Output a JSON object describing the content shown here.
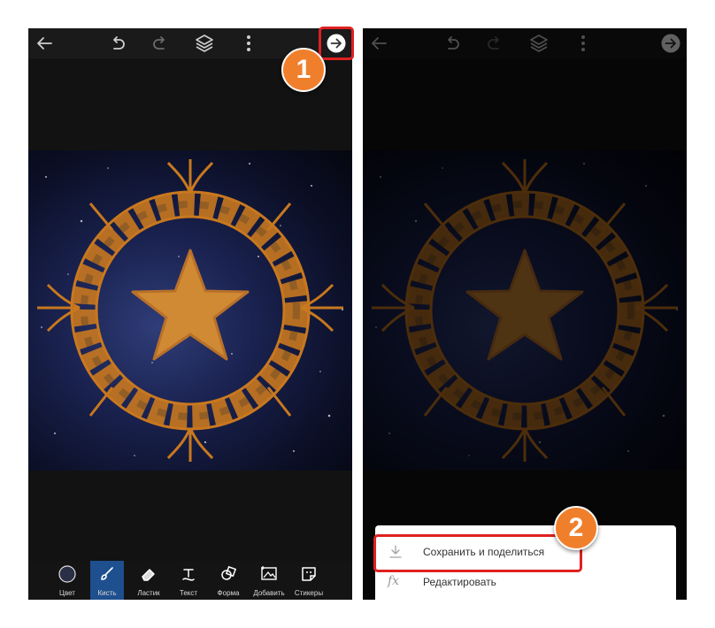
{
  "colors": {
    "accent_orange": "#f07f2c",
    "highlight_red": "#e02020",
    "active_tool_blue": "#1e4f8e",
    "ornament_orange": "#c8781f",
    "canvas_night": "#1a2250"
  },
  "left_screen": {
    "topbar_icons": [
      "back-arrow-icon",
      "undo-icon",
      "redo-icon",
      "layers-icon",
      "more-vertical-icon",
      "next-arrow-icon"
    ],
    "tools": [
      {
        "label": "Цвет",
        "icon": "color-circle-icon",
        "active": false
      },
      {
        "label": "Кисть",
        "icon": "brush-icon",
        "active": true
      },
      {
        "label": "Ластик",
        "icon": "eraser-icon",
        "active": false
      },
      {
        "label": "Текст",
        "icon": "text-icon",
        "active": false
      },
      {
        "label": "Форма",
        "icon": "shape-icon",
        "active": false
      },
      {
        "label": "Добавить",
        "icon": "add-image-icon",
        "active": false
      },
      {
        "label": "Стикеры",
        "icon": "sticker-icon",
        "active": false
      }
    ],
    "step_badge": "1"
  },
  "right_screen": {
    "menu": [
      {
        "label": "Сохранить и поделиться",
        "icon": "download-icon"
      },
      {
        "label": "Редактировать",
        "icon": "fx-icon",
        "icon_text": "fx"
      }
    ],
    "step_badge": "2"
  }
}
